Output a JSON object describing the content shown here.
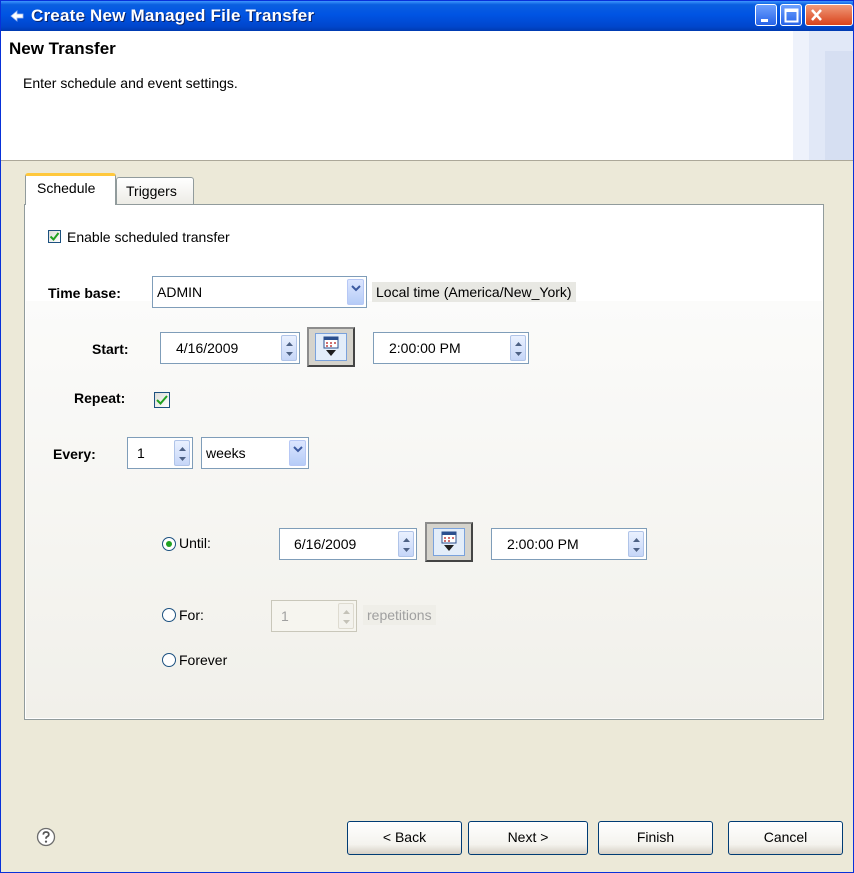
{
  "window": {
    "title": "Create New Managed File Transfer"
  },
  "header": {
    "title": "New Transfer",
    "description": "Enter schedule and event settings."
  },
  "tabs": [
    {
      "label": "Schedule",
      "selected": true
    },
    {
      "label": "Triggers",
      "selected": false
    }
  ],
  "schedule": {
    "enable_label": "Enable scheduled transfer",
    "enable_checked": true,
    "time_base_label": "Time base:",
    "time_base_value": "ADMIN",
    "time_zone_note": "Local time (America/New_York)",
    "start_label": "Start:",
    "start_date": "4/16/2009",
    "start_time": "2:00:00 PM",
    "repeat_label": "Repeat:",
    "repeat_checked": true,
    "every_label": "Every:",
    "every_value": "1",
    "every_unit": "weeks",
    "until_label": "Until:",
    "until_selected": true,
    "until_date": "6/16/2009",
    "until_time": "2:00:00 PM",
    "for_label": "For:",
    "for_value": "1",
    "repetitions_label": "repetitions",
    "forever_label": "Forever"
  },
  "buttons": {
    "back": "< Back",
    "next": "Next >",
    "finish": "Finish",
    "cancel": "Cancel"
  },
  "icons": {
    "help": "help-icon",
    "calendar": "calendar-icon",
    "app": "app-icon"
  },
  "colors": {
    "titlebar": "#0054e3",
    "tab_highlight": "#ffc83c",
    "checkmark": "#21a121"
  }
}
